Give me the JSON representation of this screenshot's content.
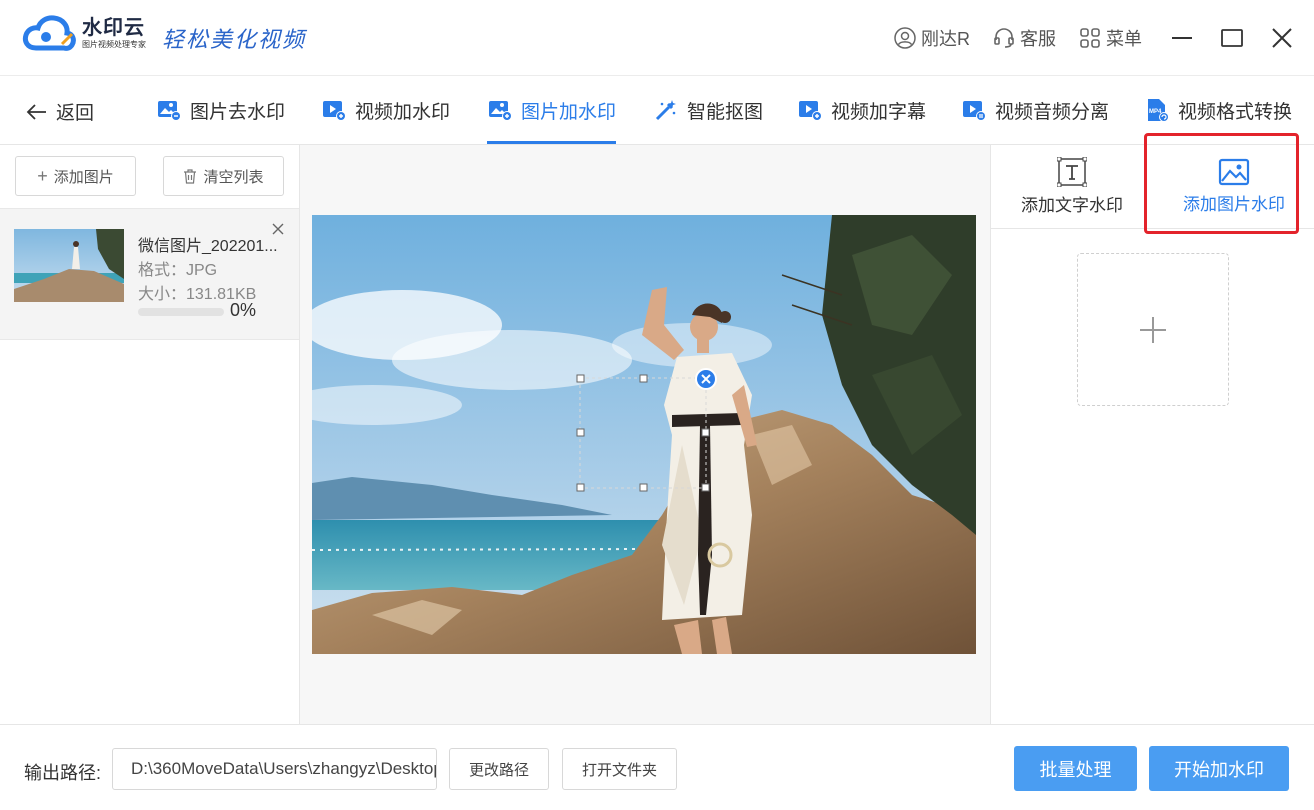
{
  "titlebar": {
    "app_name": "水印云",
    "app_subtitle": "图片视频处理专家",
    "slogan": "轻松美化视频",
    "user_name": "刚达R",
    "service_label": "客服",
    "menu_label": "菜单"
  },
  "nav": {
    "back_label": "返回",
    "tabs": [
      {
        "label": "图片去水印",
        "icon": "image-remove-icon"
      },
      {
        "label": "视频加水印",
        "icon": "video-add-icon"
      },
      {
        "label": "图片加水印",
        "icon": "image-add-icon",
        "active": true
      },
      {
        "label": "智能抠图",
        "icon": "magic-wand-icon"
      },
      {
        "label": "视频加字幕",
        "icon": "video-subtitle-icon"
      },
      {
        "label": "视频音频分离",
        "icon": "video-audio-icon"
      },
      {
        "label": "视频格式转换",
        "icon": "mp4-convert-icon"
      }
    ]
  },
  "left_panel": {
    "add_image_label": "添加图片",
    "clear_list_label": "清空列表",
    "files": [
      {
        "name": "微信图片_202201...",
        "format": "格式：JPG",
        "size": "大小：131.81KB",
        "progress": 0,
        "progress_text": "0%"
      }
    ]
  },
  "right_panel": {
    "tab_text_watermark": "添加文字水印",
    "tab_image_watermark": "添加图片水印"
  },
  "bottom": {
    "output_label": "输出路径:",
    "output_path": "D:\\360MoveData\\Users\\zhangyz\\Desktop",
    "change_path_label": "更改路径",
    "open_folder_label": "打开文件夹",
    "batch_label": "批量处理",
    "start_label": "开始加水印"
  },
  "colors": {
    "accent": "#2b7de9",
    "primary_button": "#4a9df2",
    "highlight": "#e3232b"
  }
}
